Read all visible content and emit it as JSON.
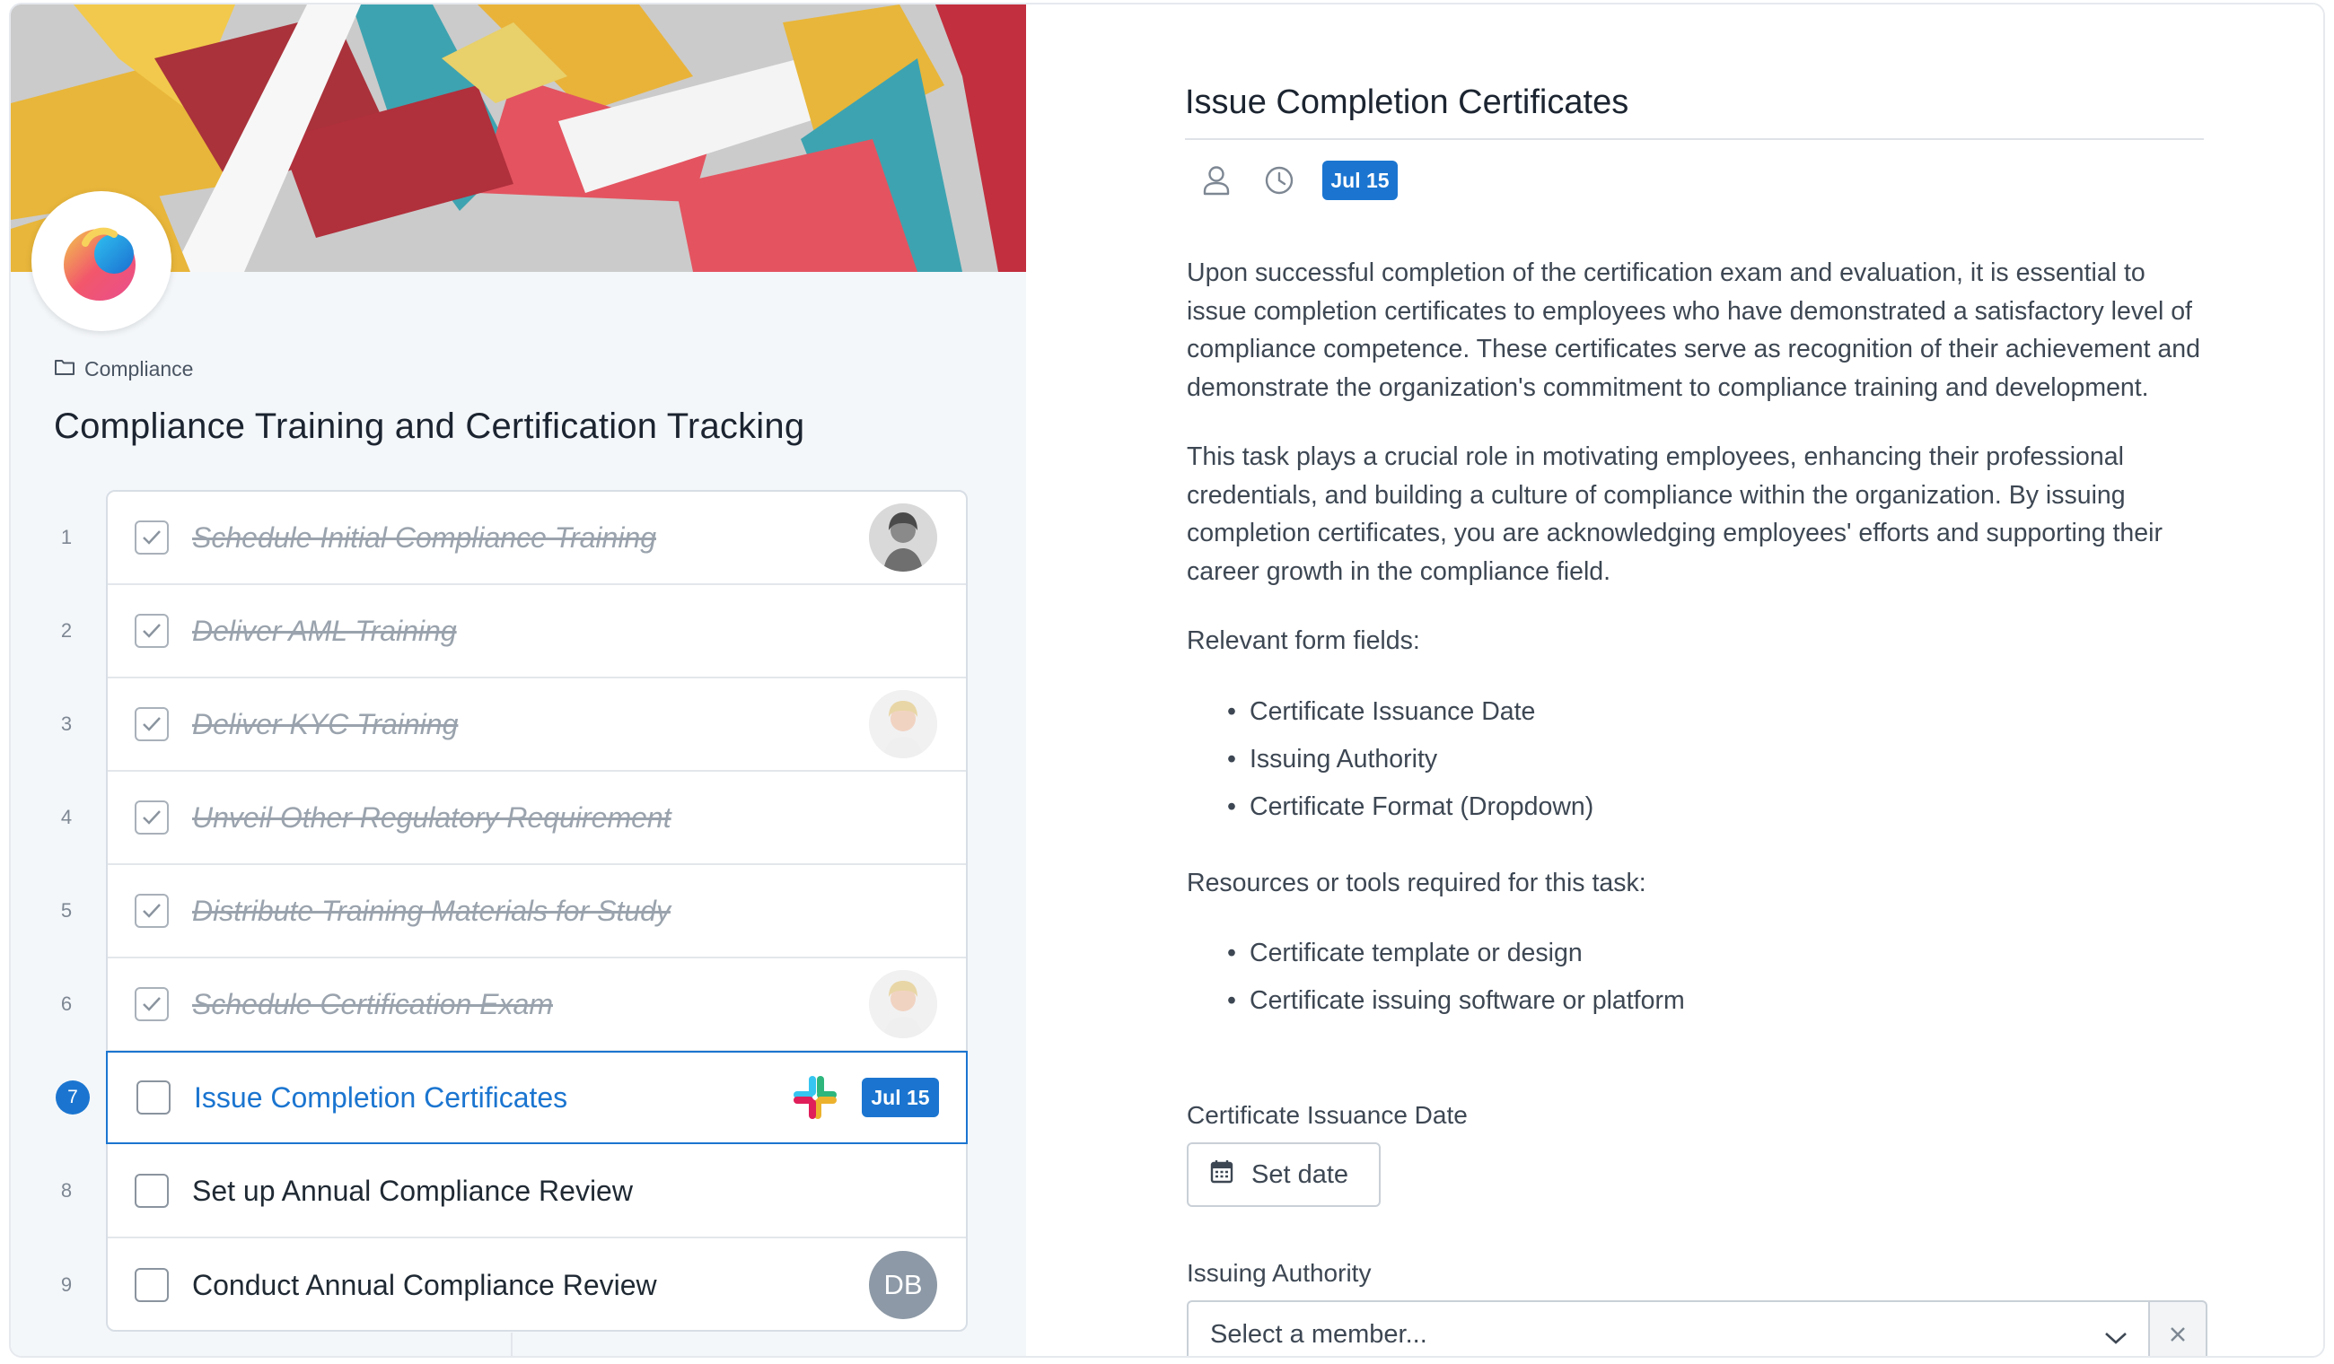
{
  "colors": {
    "accent": "#1b75d0",
    "done_text": "#9aa3ad",
    "panel_bg": "#f4f7fa"
  },
  "breadcrumb": {
    "icon": "folder-icon",
    "label": "Compliance"
  },
  "page_title": "Compliance Training and Certification Tracking",
  "tasks": [
    {
      "num": "1",
      "label": "Schedule Initial Compliance Training",
      "done": true,
      "avatar": "photo"
    },
    {
      "num": "2",
      "label": "Deliver AML Training",
      "done": true
    },
    {
      "num": "3",
      "label": "Deliver KYC Training",
      "done": true,
      "avatar": "photo"
    },
    {
      "num": "4",
      "label": "Unveil Other Regulatory Requirement",
      "done": true
    },
    {
      "num": "5",
      "label": "Distribute Training Materials for Study",
      "done": true
    },
    {
      "num": "6",
      "label": "Schedule Certification Exam",
      "done": true,
      "avatar": "photo"
    },
    {
      "num": "7",
      "label": "Issue Completion Certificates",
      "done": false,
      "current": true,
      "integration": "slack-icon",
      "due": "Jul 15"
    },
    {
      "num": "8",
      "label": "Set up Annual Compliance Review",
      "done": false
    },
    {
      "num": "9",
      "label": "Conduct Annual Compliance Review",
      "done": false,
      "avatar_initials": "DB"
    }
  ],
  "detail": {
    "title": "Issue Completion Certificates",
    "due_badge": "Jul 15",
    "paragraph1": "Upon successful completion of the certification exam and evaluation, it is essential to issue completion certificates to employees who have demonstrated a satisfactory level of compliance competence. These certificates serve as recognition of their achievement and demonstrate the organization's commitment to compliance training and development.",
    "paragraph2": "This task plays a crucial role in motivating employees, enhancing their professional credentials, and building a culture of compliance within the organization. By issuing completion certificates, you are acknowledging employees' efforts and supporting their career growth in the compliance field.",
    "form_fields_heading": "Relevant form fields:",
    "form_fields": [
      "Certificate Issuance Date",
      "Issuing Authority",
      "Certificate Format (Dropdown)"
    ],
    "resources_heading": "Resources or tools required for this task:",
    "resources": [
      "Certificate template or design",
      "Certificate issuing software or platform"
    ],
    "fields": {
      "issuance_date_label": "Certificate Issuance Date",
      "set_date_button": "Set date",
      "issuing_authority_label": "Issuing Authority",
      "member_select_placeholder": "Select a member..."
    }
  }
}
